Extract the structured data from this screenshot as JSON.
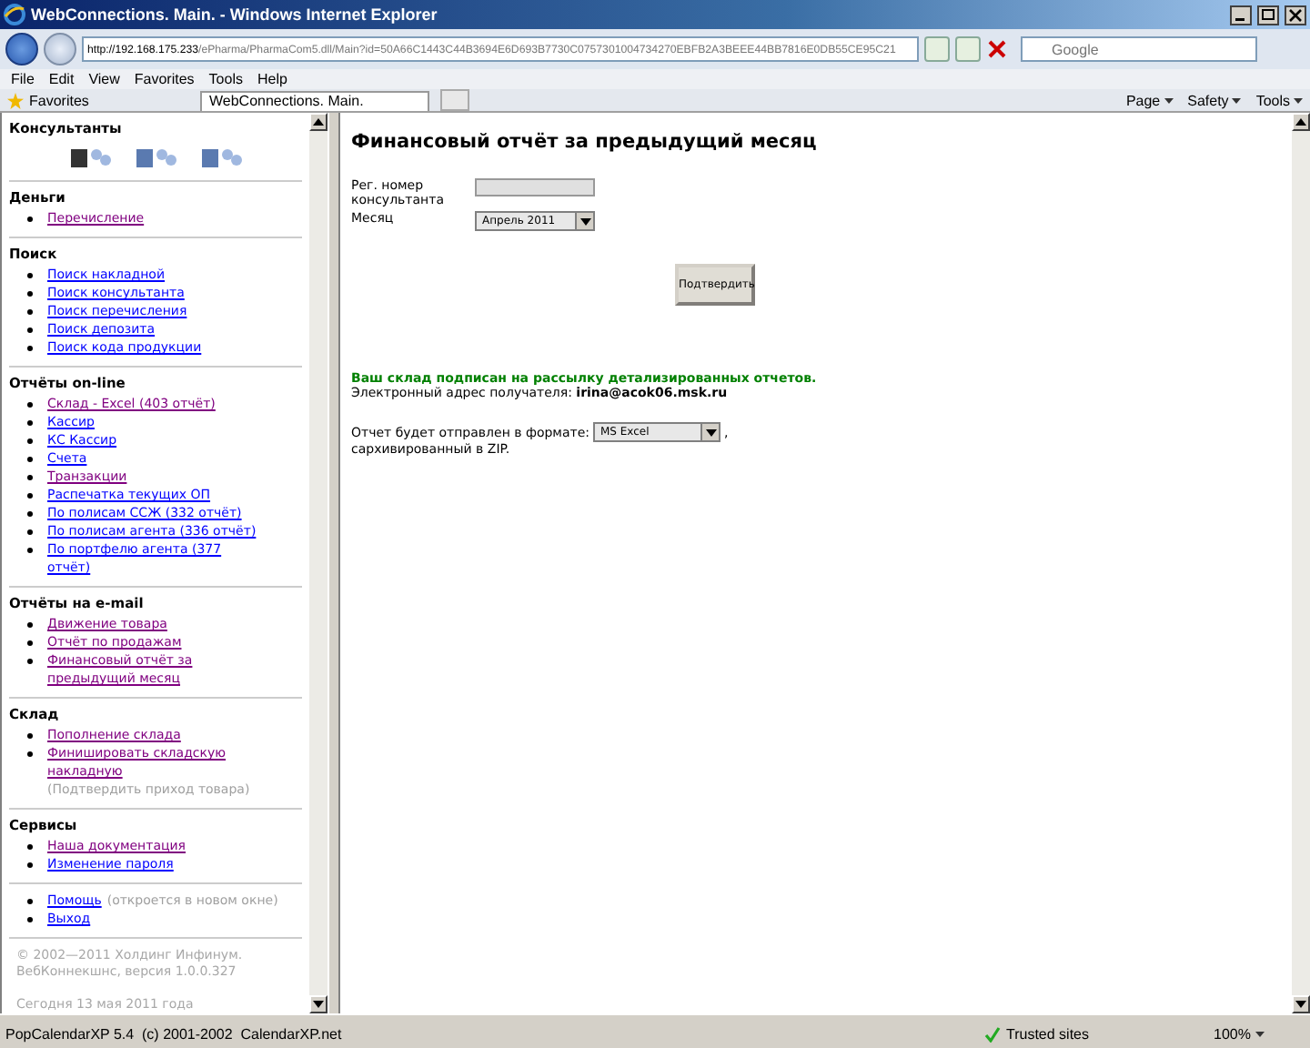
{
  "window": {
    "title": "WebConnections. Main. - Windows Internet Explorer"
  },
  "address_bar": {
    "url_host": "http://192.168.175.233",
    "url_path": "/ePharma/PharmaCom5.dll/Main?id=50A66C1443C44B3694E6D693B7730C0757301004734270EBFB2A3BEEE44BB7816E0DB55CE95C21"
  },
  "search": {
    "placeholder": "Google"
  },
  "menu": [
    "File",
    "Edit",
    "View",
    "Favorites",
    "Tools",
    "Help"
  ],
  "favorites": {
    "label": "Favorites"
  },
  "tab": {
    "label": "WebConnections. Main."
  },
  "command_bar": [
    "Page",
    "Safety",
    "Tools"
  ],
  "sidebar": {
    "sections": [
      {
        "heading": "Консультанты"
      },
      {
        "heading": "Деньги",
        "items": [
          {
            "label": "Перечисление",
            "visited": true
          }
        ]
      },
      {
        "heading": "Поиск",
        "items": [
          {
            "label": "Поиск накладной",
            "visited": false
          },
          {
            "label": "Поиск консультанта",
            "visited": false
          },
          {
            "label": "Поиск перечисления",
            "visited": false
          },
          {
            "label": "Поиск депозита",
            "visited": false
          },
          {
            "label": "Поиск кода продукции",
            "visited": false
          }
        ]
      },
      {
        "heading": "Отчёты on-line",
        "items": [
          {
            "label": "Склад - Excel (403 отчёт)",
            "visited": true
          },
          {
            "label": "Кассир",
            "visited": false
          },
          {
            "label": "КС Кассир",
            "visited": false
          },
          {
            "label": "Счета",
            "visited": false
          },
          {
            "label": "Транзакции",
            "visited": true
          },
          {
            "label": "Распечатка текущих ОП",
            "visited": false
          },
          {
            "label": "По полисам ССЖ (332 отчёт)",
            "visited": false
          },
          {
            "label": "По полисам агента (336 отчёт)",
            "visited": false
          },
          {
            "label": "По портфелю агента (377 отчёт)",
            "visited": false
          }
        ]
      },
      {
        "heading": "Отчёты на e-mail",
        "items": [
          {
            "label": "Движение товара",
            "visited": true
          },
          {
            "label": "Отчёт по продажам",
            "visited": true
          },
          {
            "label": "Финансовый отчёт за предыдущий месяц",
            "visited": true
          }
        ]
      },
      {
        "heading": "Склад",
        "items": [
          {
            "label": "Пополнение склада",
            "visited": true
          },
          {
            "label": "Финишировать складскую накладную",
            "visited": true,
            "note": "(Подтвердить приход товара)"
          }
        ]
      },
      {
        "heading": "Сервисы",
        "items": [
          {
            "label": "Наша документация",
            "visited": true
          },
          {
            "label": "Изменение пароля",
            "visited": false
          }
        ]
      },
      {
        "items": [
          {
            "label": "Помощь",
            "visited": false,
            "note": "(откроется в новом окне)"
          },
          {
            "label": "Выход",
            "visited": false
          }
        ]
      }
    ],
    "copyright": "© 2002—2011 Холдинг Инфинум. ВебКоннекшнс, версия 1.0.0.327",
    "today": "Сегодня 13 мая 2011 года"
  },
  "main": {
    "heading": "Финансовый отчёт за предыдущий месяц",
    "reg_label": "Рег. номер консультанта",
    "month_label": "Месяц",
    "month_value": "Апрель 2011",
    "submit": "Подтвердить",
    "notice": "Ваш склад подписан на рассылку детализированных отчетов.",
    "recipient": "Электронный адрес получателя: **irina@acok06.msk.ru**",
    "format_before": "Отчет будет отправлен в формате:",
    "format_value": "MS Excel",
    "format_after": ",",
    "format_tail": "сархивированный в ZIP."
  },
  "status_bar": {
    "text": "PopCalendarXP 5.4  (c) 2001-2002  CalendarXP.net",
    "zone": "Trusted sites",
    "zoom": "100%"
  }
}
